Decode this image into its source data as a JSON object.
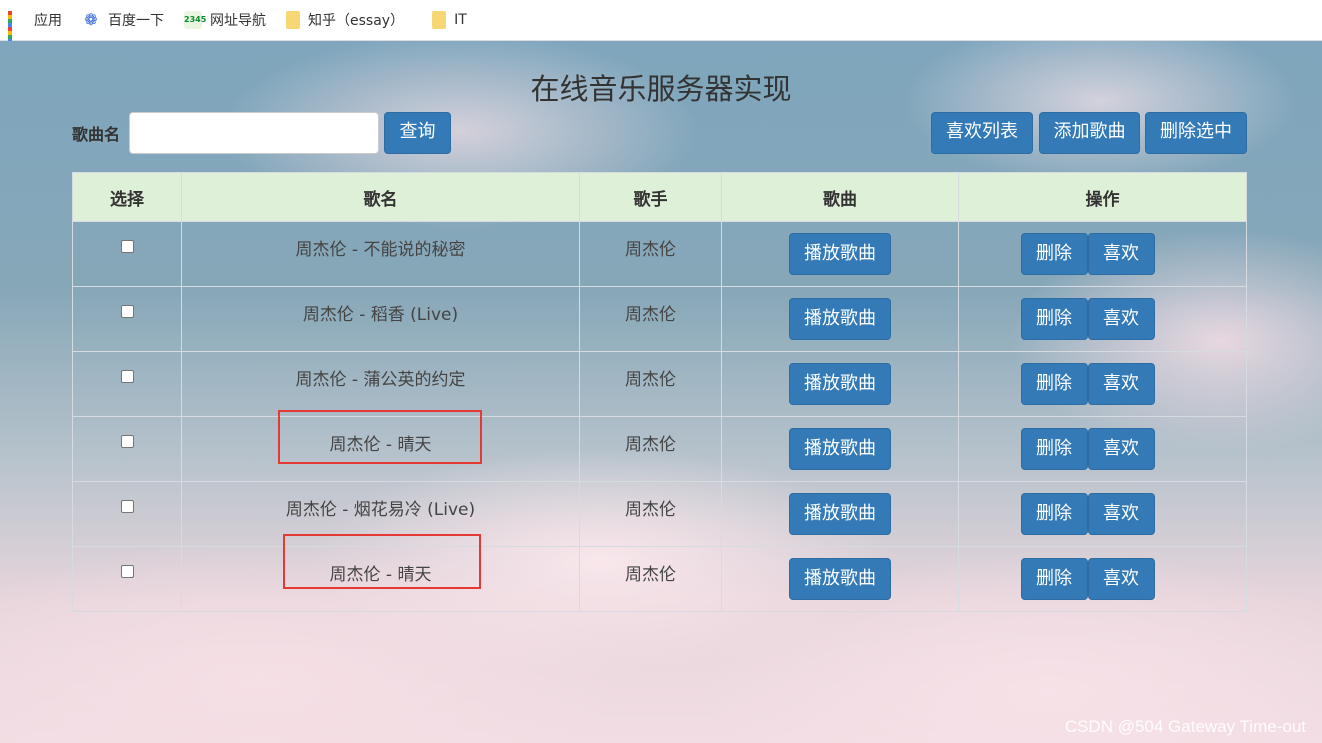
{
  "bookmarks": [
    {
      "icon": "apps-grid-icon",
      "label": "应用"
    },
    {
      "icon": "baidu-paw-icon",
      "label": "百度一下"
    },
    {
      "icon": "nav-2345-icon",
      "label": "网址导航"
    },
    {
      "icon": "folder-icon",
      "label": "知乎（essay）"
    },
    {
      "icon": "folder-icon",
      "label": "IT"
    }
  ],
  "page": {
    "title": "在线音乐服务器实现",
    "search": {
      "label": "歌曲名",
      "value": "",
      "placeholder": "",
      "button": "查询"
    },
    "toolbar": {
      "fav_list": "喜欢列表",
      "add_song": "添加歌曲",
      "delete_selected": "删除选中"
    }
  },
  "table": {
    "headers": [
      "选择",
      "歌名",
      "歌手",
      "歌曲",
      "操作"
    ],
    "rows": [
      {
        "title": "周杰伦 - 不能说的秘密",
        "singer": "周杰伦",
        "play": "播放歌曲",
        "delete": "删除",
        "like": "喜欢"
      },
      {
        "title": "周杰伦 - 稻香 (Live)",
        "singer": "周杰伦",
        "play": "播放歌曲",
        "delete": "删除",
        "like": "喜欢"
      },
      {
        "title": "周杰伦 - 蒲公英的约定",
        "singer": "周杰伦",
        "play": "播放歌曲",
        "delete": "删除",
        "like": "喜欢"
      },
      {
        "title": "周杰伦 - 晴天",
        "singer": "周杰伦",
        "play": "播放歌曲",
        "delete": "删除",
        "like": "喜欢"
      },
      {
        "title": "周杰伦 - 烟花易冷 (Live)",
        "singer": "周杰伦",
        "play": "播放歌曲",
        "delete": "删除",
        "like": "喜欢"
      },
      {
        "title": "周杰伦 - 晴天",
        "singer": "周杰伦",
        "play": "播放歌曲",
        "delete": "删除",
        "like": "喜欢"
      }
    ]
  },
  "annotation_color": "#e53935",
  "primary_button_color": "#337ab7",
  "header_row_color": "#dff0d8",
  "watermark": "CSDN @504 Gateway Time-out"
}
